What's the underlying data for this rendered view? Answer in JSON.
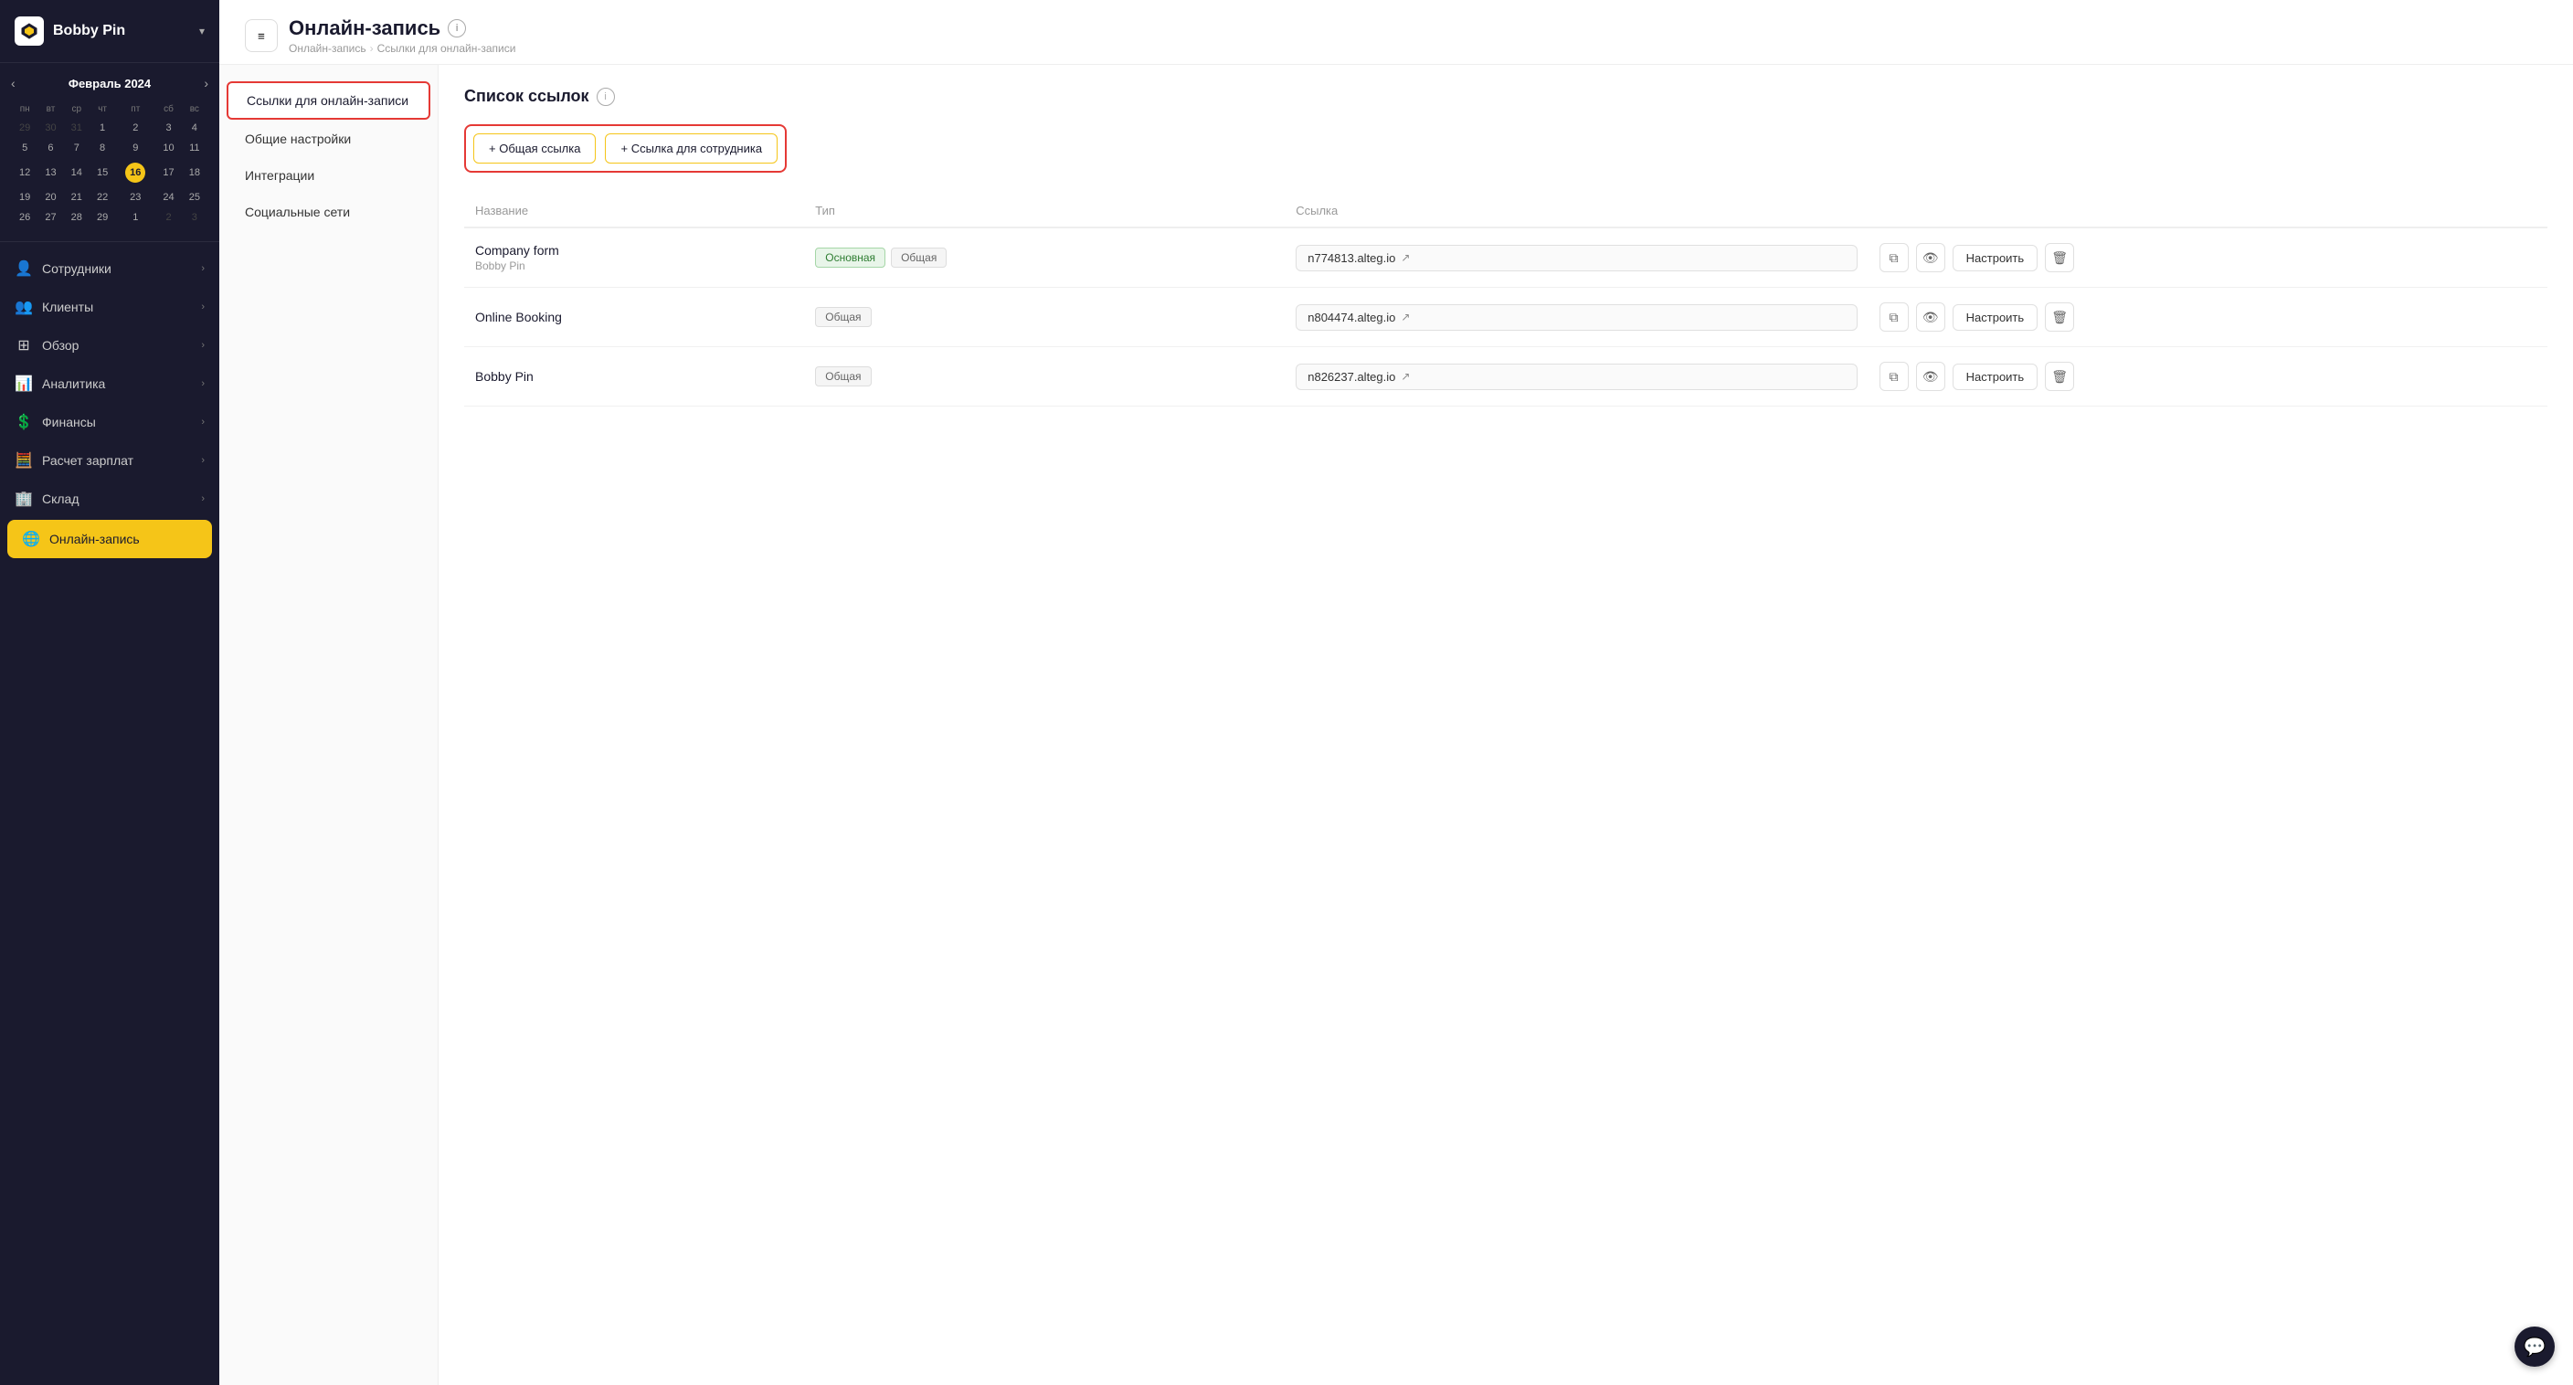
{
  "app": {
    "name": "Bobby Pin",
    "logo_alt": "Logo"
  },
  "sidebar": {
    "company_name": "Bobby Pin",
    "chevron": "▾",
    "calendar": {
      "month": "Февраль 2024",
      "days_header": [
        "пн",
        "вт",
        "ср",
        "чт",
        "пт",
        "сб",
        "вс"
      ],
      "weeks": [
        [
          "29",
          "30",
          "31",
          "1",
          "2",
          "3",
          "4"
        ],
        [
          "5",
          "6",
          "7",
          "8",
          "9",
          "10",
          "11"
        ],
        [
          "12",
          "13",
          "14",
          "15",
          "16",
          "17",
          "18"
        ],
        [
          "19",
          "20",
          "21",
          "22",
          "23",
          "24",
          "25"
        ],
        [
          "26",
          "27",
          "28",
          "29",
          "1",
          "2",
          "3"
        ]
      ],
      "today": "16",
      "prev": "‹",
      "next": "›"
    },
    "nav_items": [
      {
        "id": "employees",
        "label": "Сотрудники",
        "icon": "👤",
        "has_chevron": true
      },
      {
        "id": "clients",
        "label": "Клиенты",
        "icon": "👥",
        "has_chevron": true
      },
      {
        "id": "overview",
        "label": "Обзор",
        "icon": "⊞",
        "has_chevron": true
      },
      {
        "id": "analytics",
        "label": "Аналитика",
        "icon": "📊",
        "has_chevron": true
      },
      {
        "id": "finance",
        "label": "Финансы",
        "icon": "💲",
        "has_chevron": true
      },
      {
        "id": "payroll",
        "label": "Расчет зарплат",
        "icon": "🧮",
        "has_chevron": true
      },
      {
        "id": "warehouse",
        "label": "Склад",
        "icon": "🏢",
        "has_chevron": true
      },
      {
        "id": "online_booking",
        "label": "Онлайн-запись",
        "icon": "🌐",
        "has_chevron": false,
        "active": true
      }
    ]
  },
  "header": {
    "title": "Онлайн-запись",
    "info_icon": "i",
    "menu_icon": "≡",
    "breadcrumb": {
      "items": [
        "Онлайн-запись",
        "Ссылки для онлайн-записи"
      ],
      "separator": "›"
    }
  },
  "sub_nav": {
    "items": [
      {
        "id": "links",
        "label": "Ссылки для онлайн-записи",
        "active": true
      },
      {
        "id": "general",
        "label": "Общие настройки",
        "active": false
      },
      {
        "id": "integrations",
        "label": "Интеграции",
        "active": false
      },
      {
        "id": "social",
        "label": "Социальные сети",
        "active": false
      }
    ]
  },
  "main": {
    "section_title": "Список ссылок",
    "info_icon": "i",
    "add_general_link": "+ Общая ссылка",
    "add_employee_link": "+ Ссылка для сотрудника",
    "table": {
      "columns": [
        "Название",
        "Тип",
        "Ссылка"
      ],
      "rows": [
        {
          "name": "Company form",
          "sub": "Bobby Pin",
          "badges": [
            {
              "text": "Основная",
              "type": "green"
            },
            {
              "text": "Общая",
              "type": "gray"
            }
          ],
          "link": "n774813.alteg.io",
          "configure_label": "Настроить"
        },
        {
          "name": "Online Booking",
          "sub": "",
          "badges": [
            {
              "text": "Общая",
              "type": "gray"
            }
          ],
          "link": "n804474.alteg.io",
          "configure_label": "Настроить"
        },
        {
          "name": "Bobby Pin",
          "sub": "",
          "badges": [
            {
              "text": "Общая",
              "type": "gray"
            }
          ],
          "link": "n826237.alteg.io",
          "configure_label": "Настроить"
        }
      ]
    }
  },
  "chat": {
    "icon": "💬"
  }
}
